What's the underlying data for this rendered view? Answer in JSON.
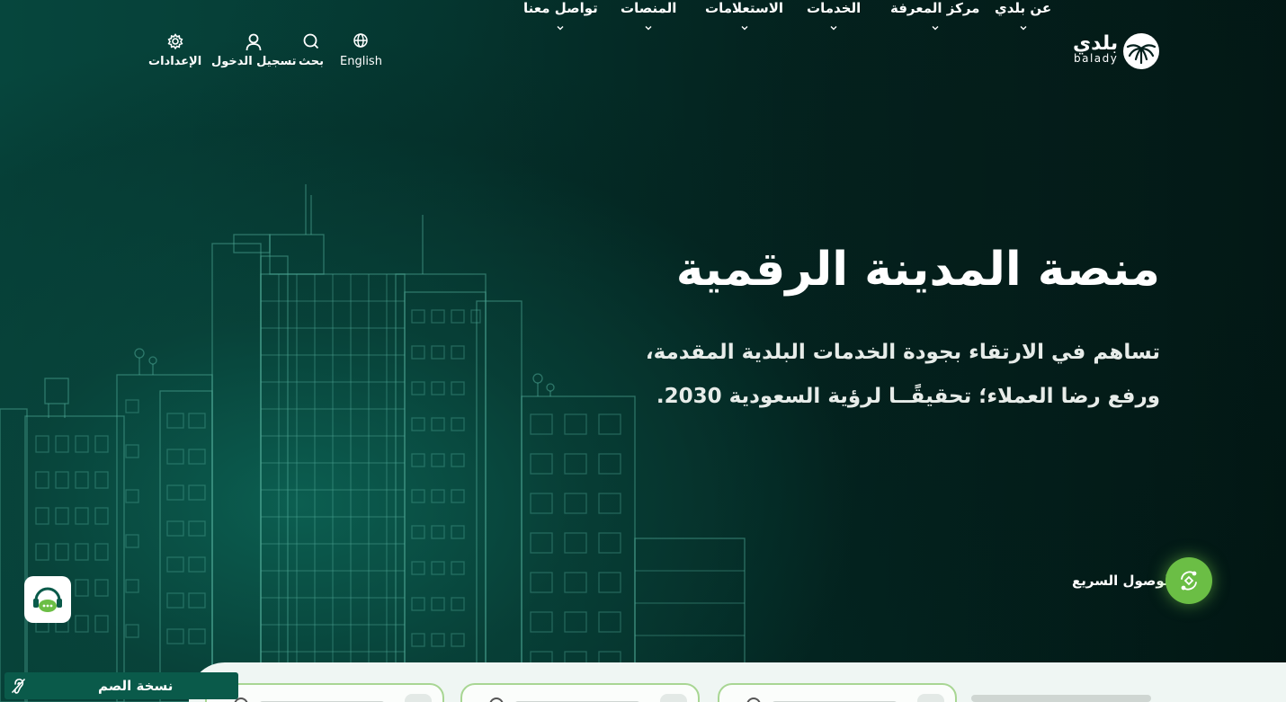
{
  "brand": {
    "logo_ar": "بلدي",
    "logo_en": "balady"
  },
  "nav": {
    "items": [
      {
        "label": "عن بلدي"
      },
      {
        "label": "مركز المعرفة"
      },
      {
        "label": "الخدمات"
      },
      {
        "label": "الاستعلامات"
      },
      {
        "label": "المنصات"
      },
      {
        "label": "تواصل معنا"
      }
    ]
  },
  "utility": {
    "language": "English",
    "search": "بحث",
    "login": "تسجيل الدخول",
    "settings": "الإعدادات"
  },
  "hero": {
    "title": "منصة المدينة الرقمية",
    "subtitle": "تساهم في الارتقاء بجودة الخدمات البلدية المقدمة، ورفع رضا العملاء؛ تحقيقًــا لرؤية السعودية 2030."
  },
  "quick_access": {
    "label": "الوصول السريع"
  },
  "accessibility": {
    "sign_language": "نسخة الصم"
  },
  "colors": {
    "accent_green": "#6bbe45",
    "card_border": "#a8d693",
    "background_dark": "#03201c"
  }
}
